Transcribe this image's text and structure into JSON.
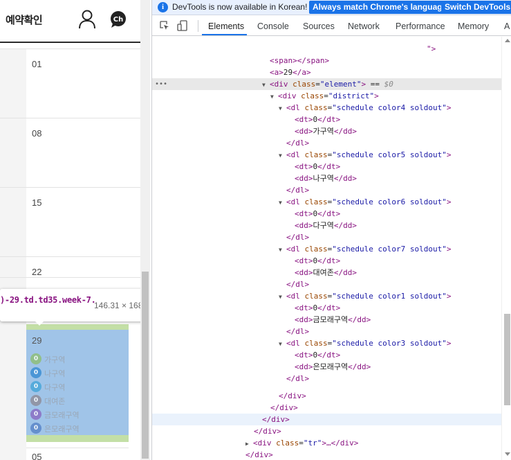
{
  "page": {
    "title": "예약확인",
    "chat_badge": "Ch",
    "weeks": [
      "01",
      "08",
      "15",
      "22"
    ],
    "highlight_day": "29",
    "next_week": "05",
    "schedules": [
      {
        "count": "0",
        "name": "가구역",
        "color": "#8fbf7a"
      },
      {
        "count": "0",
        "name": "나구역",
        "color": "#3d8fd4"
      },
      {
        "count": "0",
        "name": "다구역",
        "color": "#4aa7d9"
      },
      {
        "count": "0",
        "name": "대여존",
        "color": "#8f8f9c"
      },
      {
        "count": "0",
        "name": "금모래구역",
        "color": "#8a6fc4"
      },
      {
        "count": "0",
        "name": "은모래구역",
        "color": "#5b86c9"
      }
    ]
  },
  "tooltip": {
    "selector": ")-29.td.td35.week-7.",
    "dimensions": "146.31 × 168"
  },
  "devtools": {
    "info": {
      "text": "DevTools is now available in Korean!",
      "btn_match": "Always match Chrome's language",
      "btn_switch": "Switch DevTools t"
    },
    "tabs": [
      "Elements",
      "Console",
      "Sources",
      "Network",
      "Performance",
      "Memory",
      "A"
    ],
    "active_tab": "Elements",
    "lines": [
      {
        "top": "\">"
      },
      {
        "span": "<span></span>"
      },
      {
        "a_open": "<a>",
        "a_text": "29",
        "a_close": "</a>"
      },
      {
        "sel_tag": "<div",
        "sel_attr": "class",
        "sel_val": "\"element\"",
        "sel_end": ">",
        "sel_eq": " == ",
        "sel_var": "$0"
      },
      {
        "tag": "<div",
        "attr": "class",
        "val": "\"district\"",
        "end": ">"
      }
    ],
    "dl_class_attr": "class",
    "dl_items": [
      {
        "cls": "\"schedule color4 soldout\"",
        "dt": "0",
        "dd": "가구역"
      },
      {
        "cls": "\"schedule color5 soldout\"",
        "dt": "0",
        "dd": "나구역"
      },
      {
        "cls": "\"schedule color6 soldout\"",
        "dt": "0",
        "dd": "다구역"
      },
      {
        "cls": "\"schedule color7 soldout\"",
        "dt": "0",
        "dd": "대여존"
      },
      {
        "cls": "\"schedule color1 soldout\"",
        "dt": "0",
        "dd": "금모래구역"
      },
      {
        "cls": "\"schedule color3 soldout\"",
        "dt": "0",
        "dd": "은모래구역"
      }
    ],
    "tail": {
      "close_div": "</div>",
      "tr_tag": "<div",
      "tr_attr": "class",
      "tr_val": "\"tr\"",
      "tr_rest": ">…</div>"
    }
  }
}
